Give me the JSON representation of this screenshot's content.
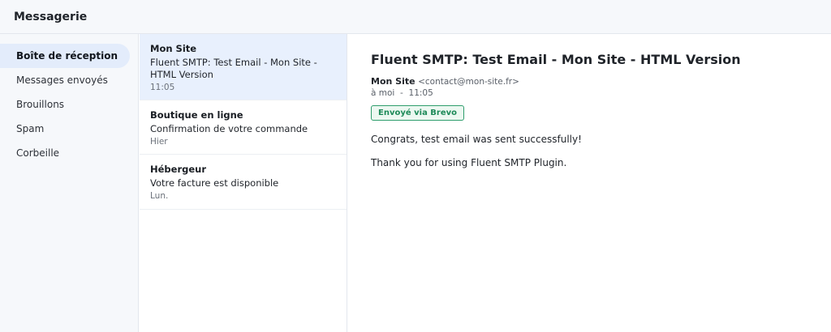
{
  "header": {
    "title": "Messagerie"
  },
  "sidebar": {
    "items": [
      {
        "label": "Boîte de réception",
        "active": true
      },
      {
        "label": "Messages envoyés",
        "active": false
      },
      {
        "label": "Brouillons",
        "active": false
      },
      {
        "label": "Spam",
        "active": false
      },
      {
        "label": "Corbeille",
        "active": false
      }
    ]
  },
  "messages": [
    {
      "sender": "Mon Site",
      "subject": "Fluent SMTP: Test Email - Mon Site - HTML Version",
      "date": "11:05",
      "selected": true
    },
    {
      "sender": "Boutique en ligne",
      "subject": "Confirmation de votre commande",
      "date": "Hier",
      "selected": false
    },
    {
      "sender": "Hébergeur",
      "subject": "Votre facture est disponible",
      "date": "Lun.",
      "selected": false
    }
  ],
  "reader": {
    "subject": "Fluent SMTP: Test Email - Mon Site - HTML Version",
    "from_name": "Mon Site",
    "from_email": "<contact@mon-site.fr>",
    "to": "à moi",
    "separator": "-",
    "time": "11:05",
    "badge": "Envoyé via Brevo",
    "body": [
      "Congrats, test email was sent successfully!",
      "Thank you for using Fluent SMTP Plugin."
    ]
  },
  "colors": {
    "accent_bg": "#e3ecfb",
    "badge_green": "#1e8a59"
  }
}
